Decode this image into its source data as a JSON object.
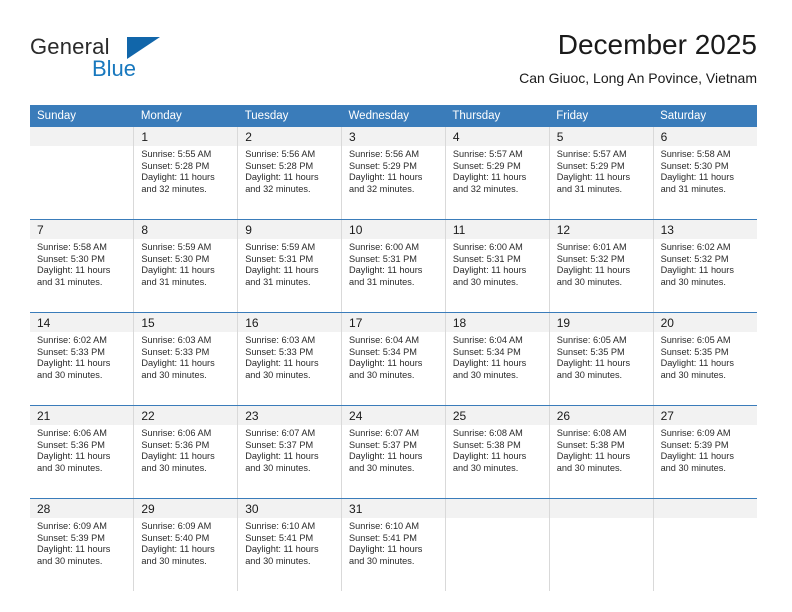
{
  "logo": {
    "line1": "General",
    "line2": "Blue",
    "icon": "triangle-logo-icon"
  },
  "header": {
    "title": "December 2025",
    "subtitle": "Can Giuoc, Long An Povince, Vietnam"
  },
  "calendar": {
    "weekday_headers": [
      "Sunday",
      "Monday",
      "Tuesday",
      "Wednesday",
      "Thursday",
      "Friday",
      "Saturday"
    ],
    "accent_color": "#3a7cba",
    "number_band_color": "#f2f2f2",
    "weeks": [
      [
        {
          "day": "",
          "detail": ""
        },
        {
          "day": "1",
          "detail": "Sunrise: 5:55 AM\nSunset: 5:28 PM\nDaylight: 11 hours and 32 minutes."
        },
        {
          "day": "2",
          "detail": "Sunrise: 5:56 AM\nSunset: 5:28 PM\nDaylight: 11 hours and 32 minutes."
        },
        {
          "day": "3",
          "detail": "Sunrise: 5:56 AM\nSunset: 5:29 PM\nDaylight: 11 hours and 32 minutes."
        },
        {
          "day": "4",
          "detail": "Sunrise: 5:57 AM\nSunset: 5:29 PM\nDaylight: 11 hours and 32 minutes."
        },
        {
          "day": "5",
          "detail": "Sunrise: 5:57 AM\nSunset: 5:29 PM\nDaylight: 11 hours and 31 minutes."
        },
        {
          "day": "6",
          "detail": "Sunrise: 5:58 AM\nSunset: 5:30 PM\nDaylight: 11 hours and 31 minutes."
        }
      ],
      [
        {
          "day": "7",
          "detail": "Sunrise: 5:58 AM\nSunset: 5:30 PM\nDaylight: 11 hours and 31 minutes."
        },
        {
          "day": "8",
          "detail": "Sunrise: 5:59 AM\nSunset: 5:30 PM\nDaylight: 11 hours and 31 minutes."
        },
        {
          "day": "9",
          "detail": "Sunrise: 5:59 AM\nSunset: 5:31 PM\nDaylight: 11 hours and 31 minutes."
        },
        {
          "day": "10",
          "detail": "Sunrise: 6:00 AM\nSunset: 5:31 PM\nDaylight: 11 hours and 31 minutes."
        },
        {
          "day": "11",
          "detail": "Sunrise: 6:00 AM\nSunset: 5:31 PM\nDaylight: 11 hours and 30 minutes."
        },
        {
          "day": "12",
          "detail": "Sunrise: 6:01 AM\nSunset: 5:32 PM\nDaylight: 11 hours and 30 minutes."
        },
        {
          "day": "13",
          "detail": "Sunrise: 6:02 AM\nSunset: 5:32 PM\nDaylight: 11 hours and 30 minutes."
        }
      ],
      [
        {
          "day": "14",
          "detail": "Sunrise: 6:02 AM\nSunset: 5:33 PM\nDaylight: 11 hours and 30 minutes."
        },
        {
          "day": "15",
          "detail": "Sunrise: 6:03 AM\nSunset: 5:33 PM\nDaylight: 11 hours and 30 minutes."
        },
        {
          "day": "16",
          "detail": "Sunrise: 6:03 AM\nSunset: 5:33 PM\nDaylight: 11 hours and 30 minutes."
        },
        {
          "day": "17",
          "detail": "Sunrise: 6:04 AM\nSunset: 5:34 PM\nDaylight: 11 hours and 30 minutes."
        },
        {
          "day": "18",
          "detail": "Sunrise: 6:04 AM\nSunset: 5:34 PM\nDaylight: 11 hours and 30 minutes."
        },
        {
          "day": "19",
          "detail": "Sunrise: 6:05 AM\nSunset: 5:35 PM\nDaylight: 11 hours and 30 minutes."
        },
        {
          "day": "20",
          "detail": "Sunrise: 6:05 AM\nSunset: 5:35 PM\nDaylight: 11 hours and 30 minutes."
        }
      ],
      [
        {
          "day": "21",
          "detail": "Sunrise: 6:06 AM\nSunset: 5:36 PM\nDaylight: 11 hours and 30 minutes."
        },
        {
          "day": "22",
          "detail": "Sunrise: 6:06 AM\nSunset: 5:36 PM\nDaylight: 11 hours and 30 minutes."
        },
        {
          "day": "23",
          "detail": "Sunrise: 6:07 AM\nSunset: 5:37 PM\nDaylight: 11 hours and 30 minutes."
        },
        {
          "day": "24",
          "detail": "Sunrise: 6:07 AM\nSunset: 5:37 PM\nDaylight: 11 hours and 30 minutes."
        },
        {
          "day": "25",
          "detail": "Sunrise: 6:08 AM\nSunset: 5:38 PM\nDaylight: 11 hours and 30 minutes."
        },
        {
          "day": "26",
          "detail": "Sunrise: 6:08 AM\nSunset: 5:38 PM\nDaylight: 11 hours and 30 minutes."
        },
        {
          "day": "27",
          "detail": "Sunrise: 6:09 AM\nSunset: 5:39 PM\nDaylight: 11 hours and 30 minutes."
        }
      ],
      [
        {
          "day": "28",
          "detail": "Sunrise: 6:09 AM\nSunset: 5:39 PM\nDaylight: 11 hours and 30 minutes."
        },
        {
          "day": "29",
          "detail": "Sunrise: 6:09 AM\nSunset: 5:40 PM\nDaylight: 11 hours and 30 minutes."
        },
        {
          "day": "30",
          "detail": "Sunrise: 6:10 AM\nSunset: 5:41 PM\nDaylight: 11 hours and 30 minutes."
        },
        {
          "day": "31",
          "detail": "Sunrise: 6:10 AM\nSunset: 5:41 PM\nDaylight: 11 hours and 30 minutes."
        },
        {
          "day": "",
          "detail": ""
        },
        {
          "day": "",
          "detail": ""
        },
        {
          "day": "",
          "detail": ""
        }
      ]
    ]
  }
}
